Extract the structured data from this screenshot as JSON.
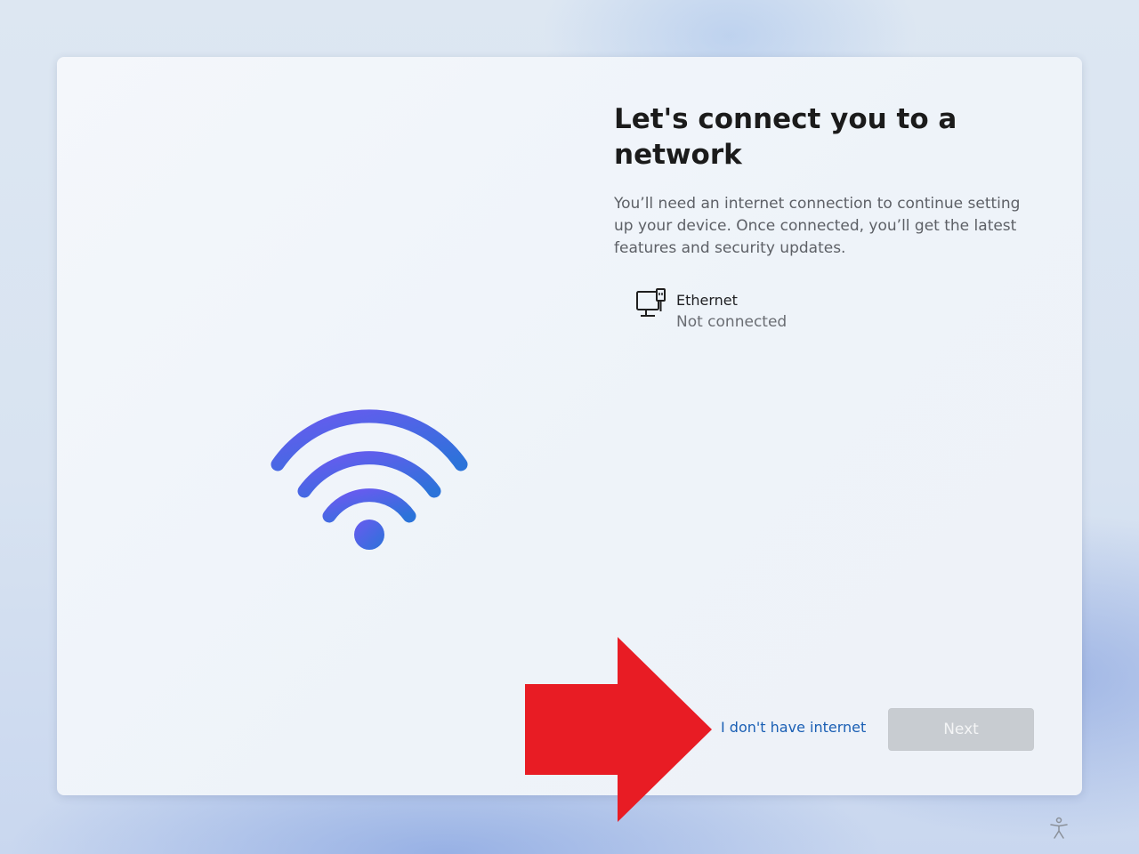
{
  "oobe": {
    "title": "Let's connect you to a network",
    "description": "You’ll need an internet connection to continue setting up your device. Once connected, you’ll get the latest features and security updates.",
    "networks": [
      {
        "name": "Ethernet",
        "status": "Not connected",
        "icon": "ethernet-icon"
      }
    ],
    "no_internet_label": "I don't have internet",
    "next_label": "Next",
    "next_enabled": false
  },
  "icons": {
    "hero": "wifi-icon",
    "annotation": "red-arrow-icon",
    "corner": "accessibility-icon"
  },
  "colors": {
    "wifi_gradient_start": "#5b5ce8",
    "wifi_gradient_end": "#2f6fdc",
    "link": "#1a5fb4",
    "arrow": "#e81c24",
    "disabled_button": "#c8ccd1"
  }
}
